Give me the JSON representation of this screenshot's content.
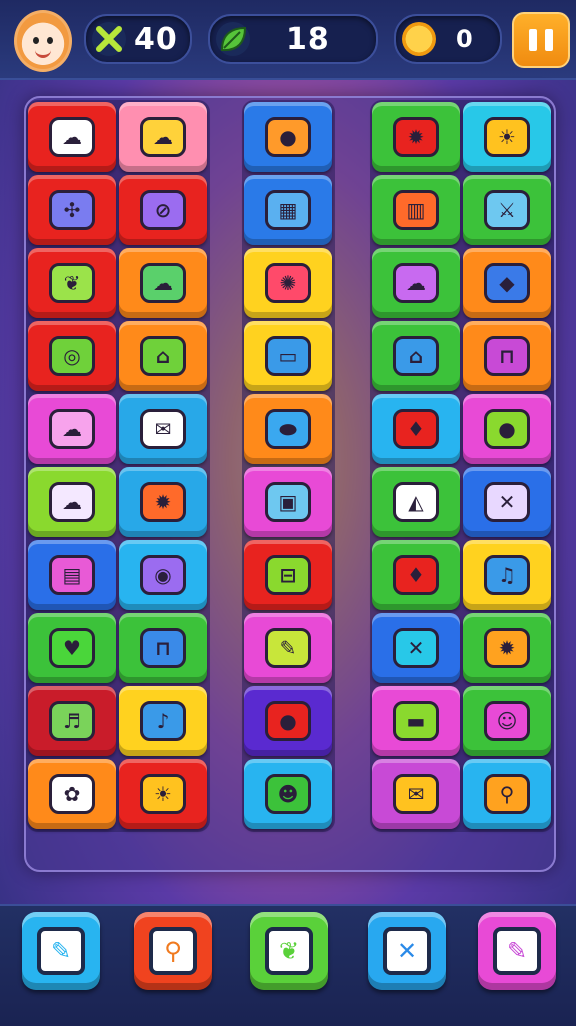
{
  "hud": {
    "avatar_icon": "fox-avatar-icon",
    "swords": {
      "icon": "crossed-swords-icon",
      "value": "40",
      "color": "#b7e63a"
    },
    "leaves": {
      "icon": "leaf-icon",
      "value": "18",
      "color": "#56c43a"
    },
    "coins": {
      "icon": "coin-icon",
      "value": "0",
      "color": "#f7b21f"
    },
    "pause_icon": "pause-icon"
  },
  "board": {
    "columns": [
      {
        "tiles": [
          {
            "color": "#e8231f",
            "icon": "cloud-icon",
            "glyph": "☁",
            "glyph_bg": "#ffffff"
          },
          {
            "color": "#ff8fb0",
            "icon": "cloud-icon",
            "glyph": "☁",
            "glyph_bg": "#ffd23a"
          },
          {
            "color": "#e8231f",
            "icon": "molecule-icon",
            "glyph": "✣",
            "glyph_bg": "#7a7cf0"
          },
          {
            "color": "#e8231f",
            "icon": "tag-icon",
            "glyph": "⊘",
            "glyph_bg": "#9b6cf0"
          },
          {
            "color": "#e8231f",
            "icon": "leaf-icon",
            "glyph": "❦",
            "glyph_bg": "#9be34a"
          },
          {
            "color": "#ff8a1a",
            "icon": "cloud-icon",
            "glyph": "☁",
            "glyph_bg": "#5ad06b"
          },
          {
            "color": "#e8231f",
            "icon": "clock-icon",
            "glyph": "◎",
            "glyph_bg": "#6fd13a"
          },
          {
            "color": "#ff8a1a",
            "icon": "bag-icon",
            "glyph": "⌂",
            "glyph_bg": "#6fd13a"
          },
          {
            "color": "#e84ad6",
            "icon": "cloud-icon",
            "glyph": "☁",
            "glyph_bg": "#f7a3ec"
          },
          {
            "color": "#28a8e8",
            "icon": "envelope-icon",
            "glyph": "✉",
            "glyph_bg": "#ffffff"
          },
          {
            "color": "#8ad92e",
            "icon": "cloud-icon",
            "glyph": "☁",
            "glyph_bg": "#f4e8ff"
          },
          {
            "color": "#28a8e8",
            "icon": "sun-icon",
            "glyph": "✹",
            "glyph_bg": "#ff6a2a"
          },
          {
            "color": "#2a6fe8",
            "icon": "chest-icon",
            "glyph": "▤",
            "glyph_bg": "#e85ad6"
          },
          {
            "color": "#28b4f0",
            "icon": "target-icon",
            "glyph": "◉",
            "glyph_bg": "#9b6cf0"
          },
          {
            "color": "#3cc23a",
            "icon": "heart-icon",
            "glyph": "♥",
            "glyph_bg": "#4ad63a"
          },
          {
            "color": "#3cc23a",
            "icon": "pot-icon",
            "glyph": "⊓",
            "glyph_bg": "#3a8ae8"
          },
          {
            "color": "#c91c2a",
            "icon": "ladder-icon",
            "glyph": "♬",
            "glyph_bg": "#7ad35a"
          },
          {
            "color": "#ffd21f",
            "icon": "music-note-icon",
            "glyph": "♪",
            "glyph_bg": "#3a9ae8"
          },
          {
            "color": "#ff8a1a",
            "icon": "flower-icon",
            "glyph": "✿",
            "glyph_bg": "#ffffff"
          },
          {
            "color": "#e8231f",
            "icon": "sun-icon",
            "glyph": "☀",
            "glyph_bg": "#ffc21f"
          }
        ]
      },
      {
        "tiles": [
          {
            "color": "#2a7ae8",
            "icon": "fruit-icon",
            "glyph": "●",
            "glyph_bg": "#ff9a2a"
          },
          {
            "color": "#2a7ae8",
            "icon": "cart-icon",
            "glyph": "▦",
            "glyph_bg": "#5ab0f0"
          },
          {
            "color": "#ffd21f",
            "icon": "splat-icon",
            "glyph": "✺",
            "glyph_bg": "#ff4a6a"
          },
          {
            "color": "#ffd21f",
            "icon": "case-icon",
            "glyph": "▭",
            "glyph_bg": "#3a9ae8"
          },
          {
            "color": "#ff8a1a",
            "icon": "blob-icon",
            "glyph": "⬬",
            "glyph_bg": "#3aa8f0"
          },
          {
            "color": "#e84ad6",
            "icon": "briefcase-icon",
            "glyph": "▣",
            "glyph_bg": "#6ec8f0"
          },
          {
            "color": "#e8231f",
            "icon": "toolbox-icon",
            "glyph": "⊟",
            "glyph_bg": "#8ad92e"
          },
          {
            "color": "#e84ad6",
            "icon": "pencil-icon",
            "glyph": "✎",
            "glyph_bg": "#c8e63a"
          },
          {
            "color": "#5a2ad0",
            "icon": "balloon-icon",
            "glyph": "●",
            "glyph_bg": "#e8231f"
          },
          {
            "color": "#28b4f0",
            "icon": "monster-icon",
            "glyph": "☻",
            "glyph_bg": "#3cc23a"
          }
        ]
      },
      {
        "tiles": [
          {
            "color": "#3cc23a",
            "icon": "sun-icon",
            "glyph": "✹",
            "glyph_bg": "#e8231f"
          },
          {
            "color": "#28c8e8",
            "icon": "sun-icon",
            "glyph": "☀",
            "glyph_bg": "#ffc21f"
          },
          {
            "color": "#3cc23a",
            "icon": "tower-icon",
            "glyph": "▥",
            "glyph_bg": "#ff6a2a"
          },
          {
            "color": "#3cc23a",
            "icon": "sword-icon",
            "glyph": "⚔",
            "glyph_bg": "#6ec8f0"
          },
          {
            "color": "#3cc23a",
            "icon": "cloud-icon",
            "glyph": "☁",
            "glyph_bg": "#c86af0"
          },
          {
            "color": "#ff8a1a",
            "icon": "fish-icon",
            "glyph": "◆",
            "glyph_bg": "#3a7ae8"
          },
          {
            "color": "#3cc23a",
            "icon": "basket-icon",
            "glyph": "⌂",
            "glyph_bg": "#3a9ae8"
          },
          {
            "color": "#ff8a1a",
            "icon": "pot-icon",
            "glyph": "⊓",
            "glyph_bg": "#c84ad6"
          },
          {
            "color": "#28b4f0",
            "icon": "strawberry-icon",
            "glyph": "♦",
            "glyph_bg": "#e8231f"
          },
          {
            "color": "#e84ad6",
            "icon": "ball-icon",
            "glyph": "●",
            "glyph_bg": "#8ad92e"
          },
          {
            "color": "#3cc23a",
            "icon": "tent-icon",
            "glyph": "◭",
            "glyph_bg": "#ffffff"
          },
          {
            "color": "#2a6fe8",
            "icon": "cross-icon",
            "glyph": "✕",
            "glyph_bg": "#e8d8ff"
          },
          {
            "color": "#3cc23a",
            "icon": "strawberry-icon",
            "glyph": "♦",
            "glyph_bg": "#e8231f"
          },
          {
            "color": "#ffd21f",
            "icon": "music-note-icon",
            "glyph": "♫",
            "glyph_bg": "#3a9ae8"
          },
          {
            "color": "#2a6fe8",
            "icon": "cross-icon",
            "glyph": "✕",
            "glyph_bg": "#28c8e8"
          },
          {
            "color": "#3cc23a",
            "icon": "gear-icon",
            "glyph": "✹",
            "glyph_bg": "#ffa21f"
          },
          {
            "color": "#e84ad6",
            "icon": "briefcase-icon",
            "glyph": "▬",
            "glyph_bg": "#8ad92e"
          },
          {
            "color": "#3cc23a",
            "icon": "chat-bubble-icon",
            "glyph": "☺",
            "glyph_bg": "#e84ad6"
          },
          {
            "color": "#c84ad6",
            "icon": "bag-icon",
            "glyph": "✉",
            "glyph_bg": "#ffc21f"
          },
          {
            "color": "#28b4f0",
            "icon": "magnifier-icon",
            "glyph": "⚲",
            "glyph_bg": "#ffa21f"
          }
        ]
      }
    ]
  },
  "toolbar": [
    {
      "color": "#28b4f0",
      "icon": "edit-icon",
      "glyph": "✎",
      "glyph_color": "#28b4f0"
    },
    {
      "color": "#f0431f",
      "icon": "magnifier-icon",
      "glyph": "⚲",
      "glyph_color": "#f07a1f"
    },
    {
      "color": "#5ad13a",
      "icon": "leaf-icon",
      "glyph": "❦",
      "glyph_color": "#5ad13a"
    },
    {
      "color": "#28a8f0",
      "icon": "cross-icon",
      "glyph": "✕",
      "glyph_color": "#2a8ae8"
    },
    {
      "color": "#e84ad6",
      "icon": "edit-icon",
      "glyph": "✎",
      "glyph_color": "#c84ad6"
    }
  ]
}
